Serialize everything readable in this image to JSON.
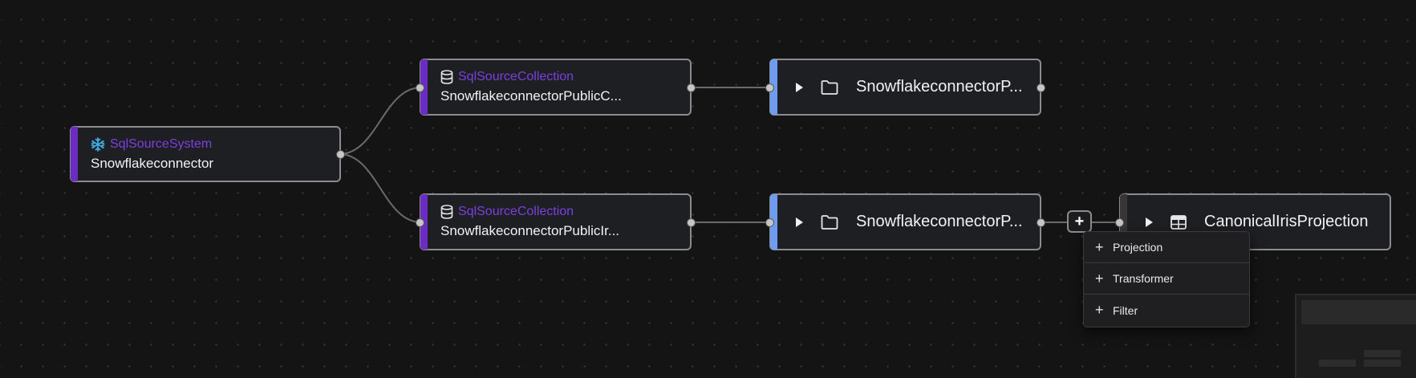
{
  "canvas": {
    "colors": {
      "background": "#141414",
      "dot": "#3a3a3a",
      "purple_accent": "#6a2cc2",
      "blue_accent": "#6f9bf0",
      "type_text": "#7c3fe0",
      "snowflake_icon": "#3fa9e0"
    }
  },
  "nodes": {
    "source_system": {
      "type_label": "SqlSourceSystem",
      "name": "Snowflakeconnector",
      "icon": "snowflake-icon"
    },
    "collection_top": {
      "type_label": "SqlSourceCollection",
      "name": "SnowflakeconnectorPublicC...",
      "icon": "database-icon"
    },
    "collection_bottom": {
      "type_label": "SqlSourceCollection",
      "name": "SnowflakeconnectorPublicIr...",
      "icon": "database-icon"
    },
    "folder_top": {
      "name": "SnowflakeconnectorP...",
      "icon": "folder-icon"
    },
    "folder_bottom": {
      "name": "SnowflakeconnectorP...",
      "icon": "folder-icon"
    },
    "projection": {
      "name": "CanonicalIrisProjection",
      "icon": "table-icon"
    }
  },
  "add_button": {
    "label": "+"
  },
  "add_menu": {
    "items": [
      {
        "label": "Projection"
      },
      {
        "label": "Transformer"
      },
      {
        "label": "Filter"
      }
    ]
  }
}
